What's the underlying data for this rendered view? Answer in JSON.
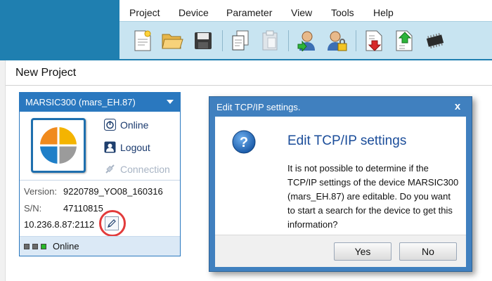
{
  "menubar": {
    "items": [
      "Project",
      "Device",
      "Parameter",
      "View",
      "Tools",
      "Help"
    ]
  },
  "toolbar": {
    "icons": [
      "new-document-icon",
      "open-folder-icon",
      "save-icon",
      "copy-icon",
      "paste-icon",
      "user-login-icon",
      "user-lock-icon",
      "download-icon",
      "upload-icon",
      "chip-icon"
    ]
  },
  "page": {
    "title": "New Project"
  },
  "device_card": {
    "title": "MARSIC300 (mars_EH.87)",
    "actions": {
      "online": "Online",
      "logout": "Logout",
      "connection": "Connection"
    },
    "version_label": "Version:",
    "version_value": "9220789_YO08_160316",
    "sn_label": "S/N:",
    "sn_value": "47110815",
    "address": "10.236.8.87:2112",
    "status": "Online",
    "led_colors": [
      "#6b6b6b",
      "#6b6b6b",
      "#28b828"
    ]
  },
  "dialog": {
    "title": "Edit TCP/IP settings.",
    "close": "x",
    "heading": "Edit TCP/IP settings",
    "message": "It is not possible to determine if the TCP/IP settings of the device MARSIC300 (mars_EH.87) are editable. Do you want to start a search for the device to get this information?",
    "yes": "Yes",
    "no": "No"
  },
  "colors": {
    "chrome_blue": "#1f7fb0",
    "toolbar_bg": "#c8e4f1",
    "card_blue": "#2a78bf",
    "dialog_frame": "#4080bf",
    "highlight_red": "#e23b3b"
  }
}
